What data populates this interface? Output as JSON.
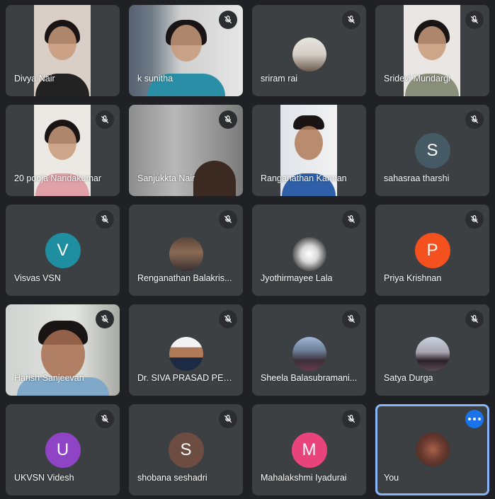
{
  "participants": [
    {
      "name": "Divya Nair",
      "muted": false
    },
    {
      "name": "k sunitha",
      "muted": true
    },
    {
      "name": "sriram rai",
      "muted": true
    },
    {
      "name": "Sridevi Mundargi",
      "muted": true
    },
    {
      "name": "20 pooja Nandakumar",
      "muted": true
    },
    {
      "name": "Sanjukkta Nair",
      "muted": true
    },
    {
      "name": "Ranganathan Kannan",
      "muted": false
    },
    {
      "name": "sahasraa tharshi",
      "muted": true,
      "initial": "S",
      "color": "#455a64"
    },
    {
      "name": "Visvas VSN",
      "muted": true,
      "initial": "V",
      "color": "#1e8ea0"
    },
    {
      "name": "Renganathan Balakris...",
      "muted": true
    },
    {
      "name": "Jyothirmayee Lala",
      "muted": true
    },
    {
      "name": "Priya Krishnan",
      "muted": true,
      "initial": "P",
      "color": "#f4511e"
    },
    {
      "name": "Harish Sanjeevan",
      "muted": true
    },
    {
      "name": "Dr. SIVA PRASAD PEN...",
      "muted": true
    },
    {
      "name": "Sheela Balasubramani...",
      "muted": true
    },
    {
      "name": "Satya Durga",
      "muted": true
    },
    {
      "name": "UKVSN Videsh",
      "muted": true,
      "initial": "U",
      "color": "#8e44c4"
    },
    {
      "name": "shobana seshadri",
      "muted": true,
      "initial": "S",
      "color": "#6d4c41"
    },
    {
      "name": "Mahalakshmi Iyadurai",
      "muted": true,
      "initial": "M",
      "color": "#e8437a"
    },
    {
      "name": "You",
      "muted": false
    }
  ],
  "colors": {
    "tile": "#3c4043",
    "background": "#202124",
    "active_border": "#8ab4f8",
    "more_button": "#1a73e8"
  }
}
